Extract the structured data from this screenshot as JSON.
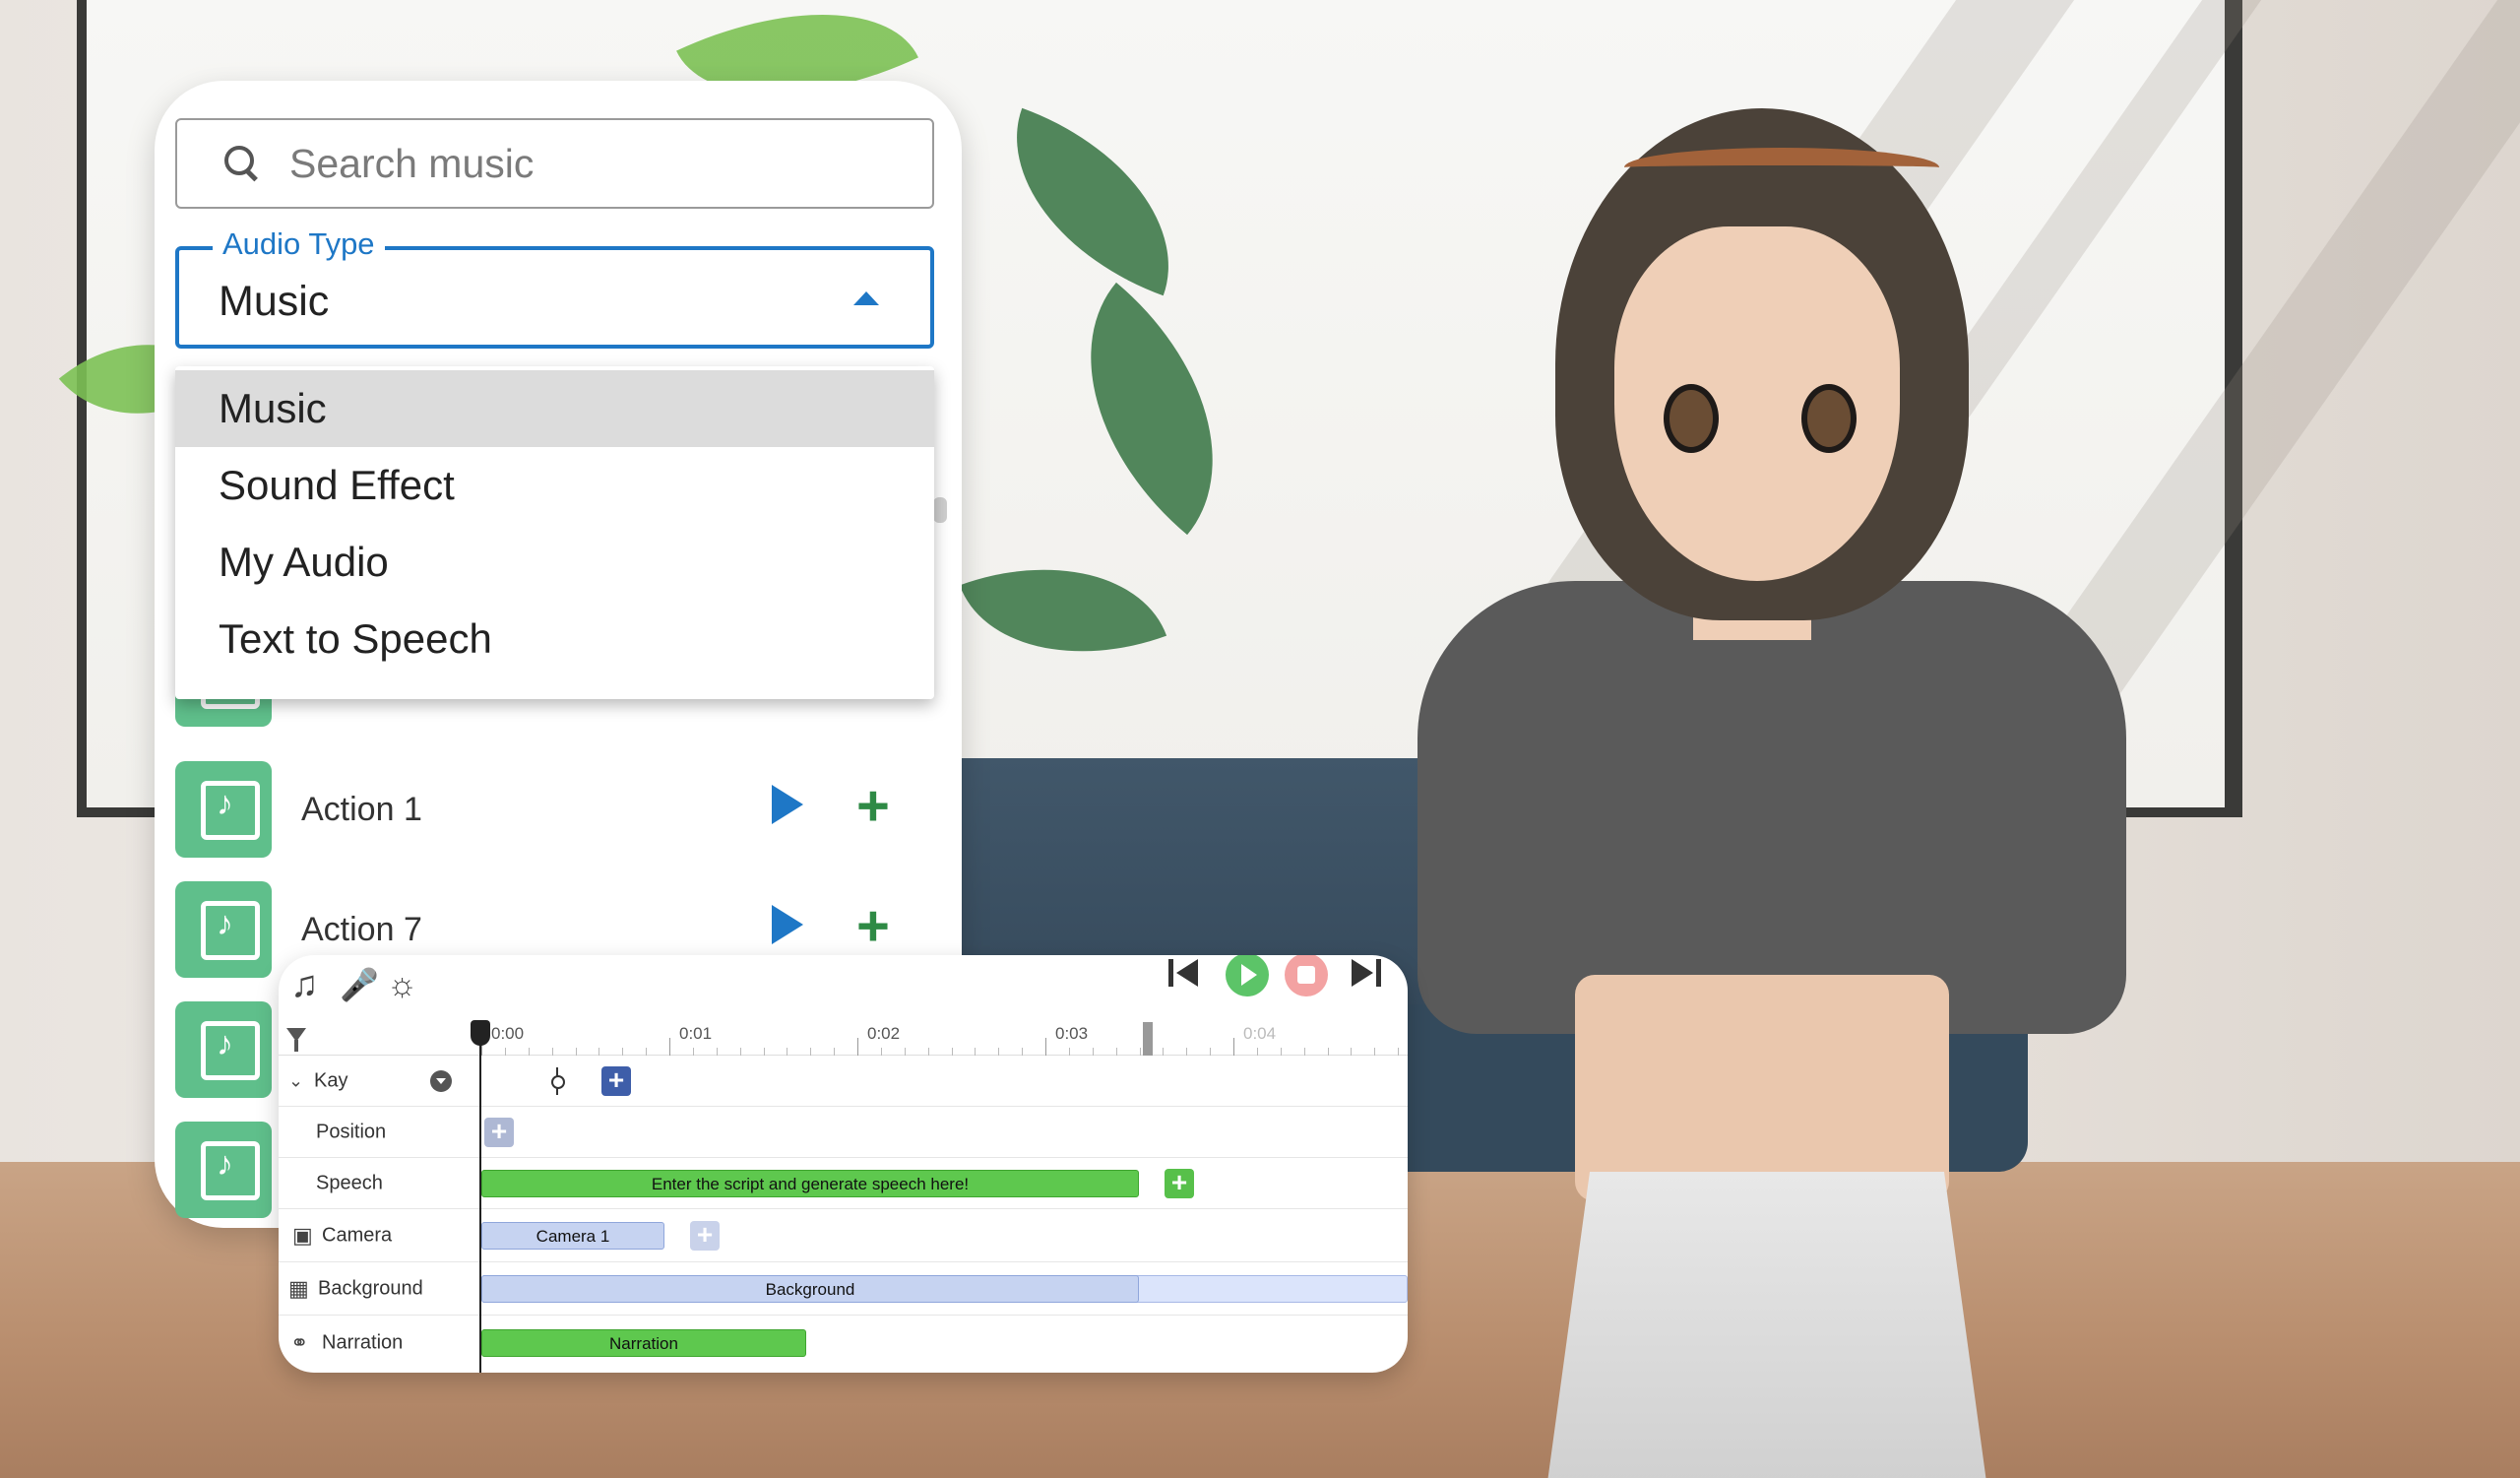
{
  "music_panel": {
    "search": {
      "placeholder": "Search music",
      "value": ""
    },
    "audio_type": {
      "legend": "Audio Type",
      "selected": "Music",
      "options": [
        "Music",
        "Sound Effect",
        "My Audio",
        "Text to Speech"
      ]
    },
    "items": [
      {
        "name": "Action 1"
      },
      {
        "name": "Action 7"
      }
    ]
  },
  "timeline": {
    "ruler": {
      "ticks": [
        "0:00",
        "0:01",
        "0:02",
        "0:03",
        "0:04"
      ]
    },
    "rows": {
      "kay": {
        "label": "Kay"
      },
      "position": {
        "label": "Position"
      },
      "speech": {
        "label": "Speech",
        "clip": "Enter the script and generate speech here!"
      },
      "camera": {
        "label": "Camera",
        "clip": "Camera 1"
      },
      "background": {
        "label": "Background",
        "clip": "Background"
      },
      "narration": {
        "label": "Narration",
        "clip": "Narration"
      }
    }
  },
  "colors": {
    "accent_blue": "#1e77c6",
    "tile_green": "#5fbf8b",
    "add_green": "#2e8a45",
    "clip_green": "#5ec84e",
    "play_green": "#5cc468",
    "stop_pink": "#f3a2a2"
  },
  "icons": {
    "toolbar": [
      "music-note-icon",
      "microphone-icon",
      "light-icon"
    ],
    "transport": [
      "skip-previous-icon",
      "play-icon",
      "stop-icon",
      "skip-next-icon"
    ]
  }
}
